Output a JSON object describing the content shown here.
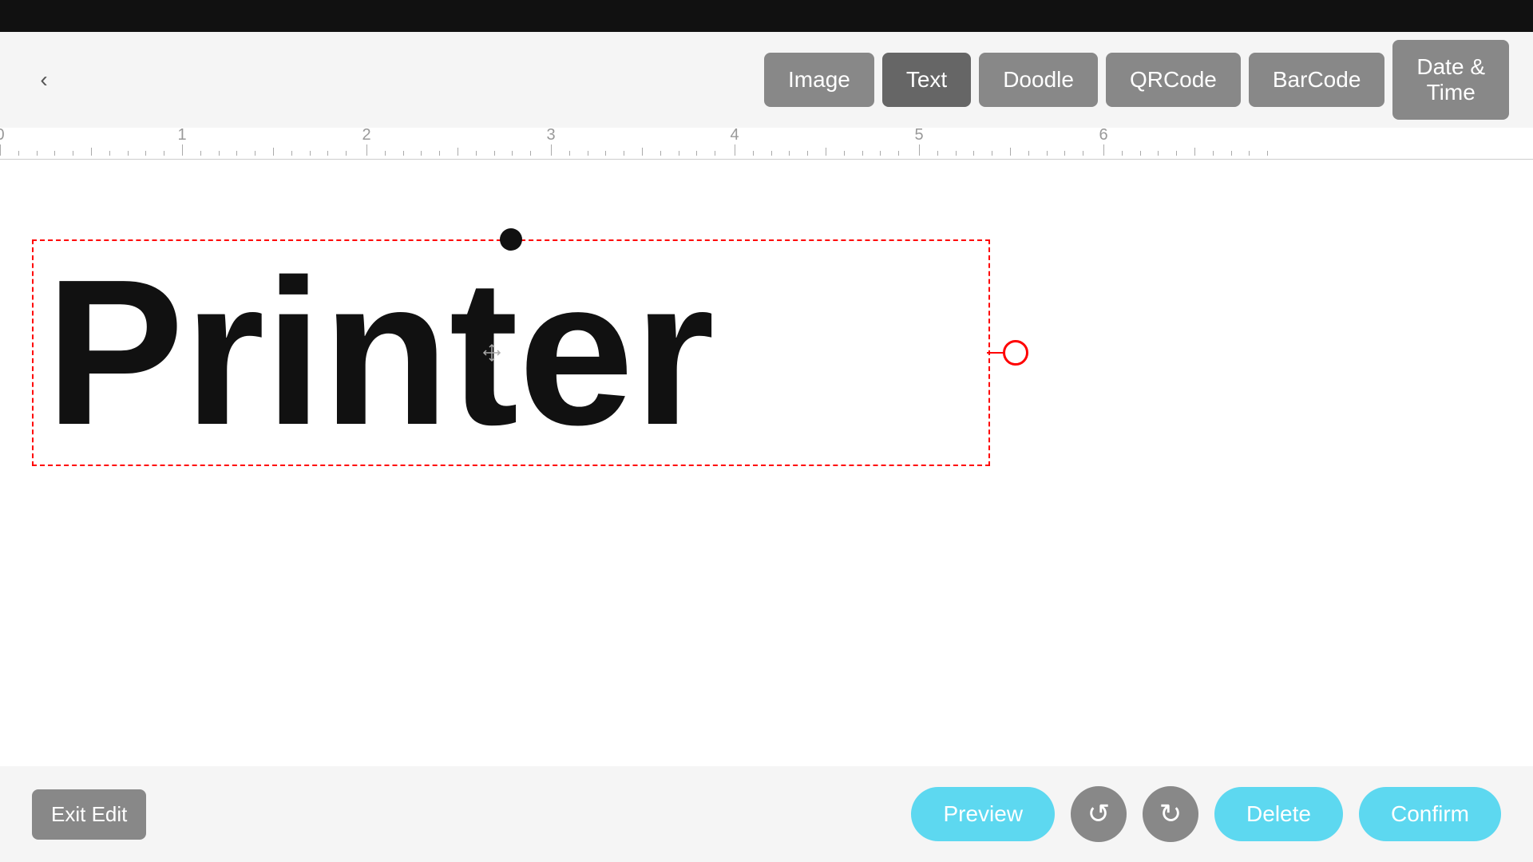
{
  "topBar": {
    "visible": true
  },
  "header": {
    "backButtonLabel": "‹",
    "buttons": [
      {
        "id": "image",
        "label": "Image",
        "active": false
      },
      {
        "id": "text",
        "label": "Text",
        "active": true
      },
      {
        "id": "doodle",
        "label": "Doodle",
        "active": false
      },
      {
        "id": "qrcode",
        "label": "QRCode",
        "active": false
      },
      {
        "id": "barcode",
        "label": "BarCode",
        "active": false
      },
      {
        "id": "datetime",
        "label": "Date &\nTime",
        "active": false
      }
    ]
  },
  "ruler": {
    "marks": [
      {
        "label": "0",
        "position": 0
      },
      {
        "label": "1",
        "position": 228
      },
      {
        "label": "2",
        "position": 459
      },
      {
        "label": "3",
        "position": 690
      },
      {
        "label": "4",
        "position": 920
      },
      {
        "label": "5",
        "position": 1151
      },
      {
        "label": "6",
        "position": 1382
      }
    ]
  },
  "canvas": {
    "textElement": {
      "text": "Printer",
      "fontSize": "260px",
      "fontWeight": "900"
    }
  },
  "bottomToolbar": {
    "exitEdit": "Exit Edit",
    "preview": "Preview",
    "undo": "undo",
    "redo": "redo",
    "delete": "Delete",
    "confirm": "Confirm"
  }
}
